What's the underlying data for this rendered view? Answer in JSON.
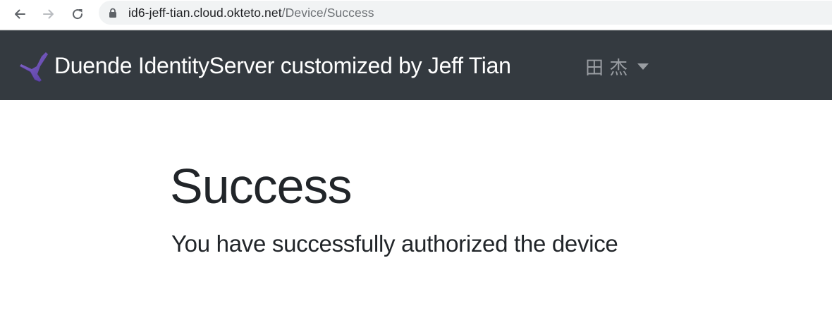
{
  "browser": {
    "url_host": "id6-jeff-tian.cloud.okteto.net",
    "url_path": "/Device/Success",
    "icons": [
      "back-icon",
      "forward-icon",
      "reload-icon",
      "lock-icon"
    ]
  },
  "navbar": {
    "brand": "Duende IdentityServer customized by Jeff Tian",
    "user_name": "田 杰",
    "logo_color": "#7b5cc7",
    "background": "#343a40"
  },
  "main": {
    "title": "Success",
    "message": "You have successfully authorized the device"
  }
}
